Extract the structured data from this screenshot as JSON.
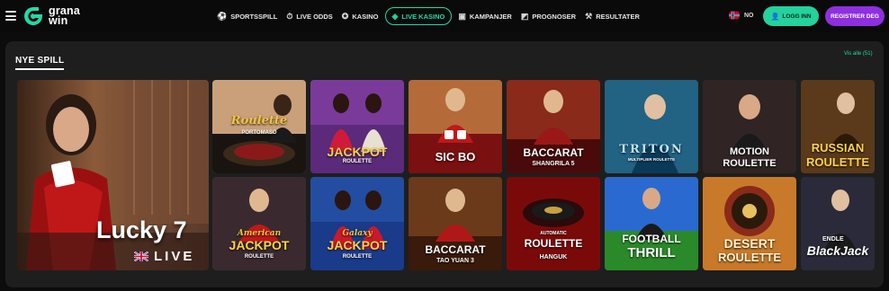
{
  "header": {
    "logo_text_line1": "grana",
    "logo_text_line2": "win",
    "nav": [
      {
        "label": "SPORTSSPILL",
        "icon": "soccer-ball-icon"
      },
      {
        "label": "LIVE ODDS",
        "icon": "stopwatch-icon"
      },
      {
        "label": "KASINO",
        "icon": "chip-icon"
      },
      {
        "label": "LIVE KASINO",
        "icon": "live-card-icon",
        "active": true
      },
      {
        "label": "KAMPANJER",
        "icon": "gift-icon"
      },
      {
        "label": "PROGNOSER",
        "icon": "cursor-chart-icon"
      },
      {
        "label": "RESULTATER",
        "icon": "trophy-icon"
      }
    ],
    "language": "NO",
    "login_label": "LOGG INN",
    "register_label": "REGISTRER DEG",
    "accent_color": "#26d8a3",
    "register_color": "#8e2fe0"
  },
  "section": {
    "title": "NYE SPILL",
    "view_all": "Vis alle (51)"
  },
  "games": {
    "featured": {
      "title": "Lucky 7",
      "subtitle": "LIVE"
    },
    "row1": [
      {
        "title": "Roulette",
        "subtitle": "PORTOMASO"
      },
      {
        "title": "JACKPOT",
        "subtitle": "ROULETTE"
      },
      {
        "title": "SIC BO",
        "subtitle": ""
      },
      {
        "title": "BACCARAT",
        "subtitle": "SHANGRILA 5"
      },
      {
        "title": "TRITON",
        "subtitle": "MULTIPLIER ROULETTE"
      },
      {
        "title": "MOTION",
        "subtitle": "ROULETTE"
      },
      {
        "title": "RUSSIAN",
        "subtitle": "ROULETTE"
      }
    ],
    "row2": [
      {
        "title": "JACKPOT",
        "subtitle": "ROULETTE",
        "prefix": "American"
      },
      {
        "title": "JACKPOT",
        "subtitle": "ROULETTE",
        "prefix": "Galaxy"
      },
      {
        "title": "BACCARAT",
        "subtitle": "TAO YUAN 3"
      },
      {
        "title": "ROULETTE",
        "subtitle": "HANGUK",
        "prefix": "AUTOMATIC"
      },
      {
        "title": "FOOTBALL",
        "subtitle": "THRILL"
      },
      {
        "title": "DESERT",
        "subtitle": "ROULETTE"
      },
      {
        "title": "BlackJack",
        "subtitle": "ENDLE"
      }
    ]
  }
}
